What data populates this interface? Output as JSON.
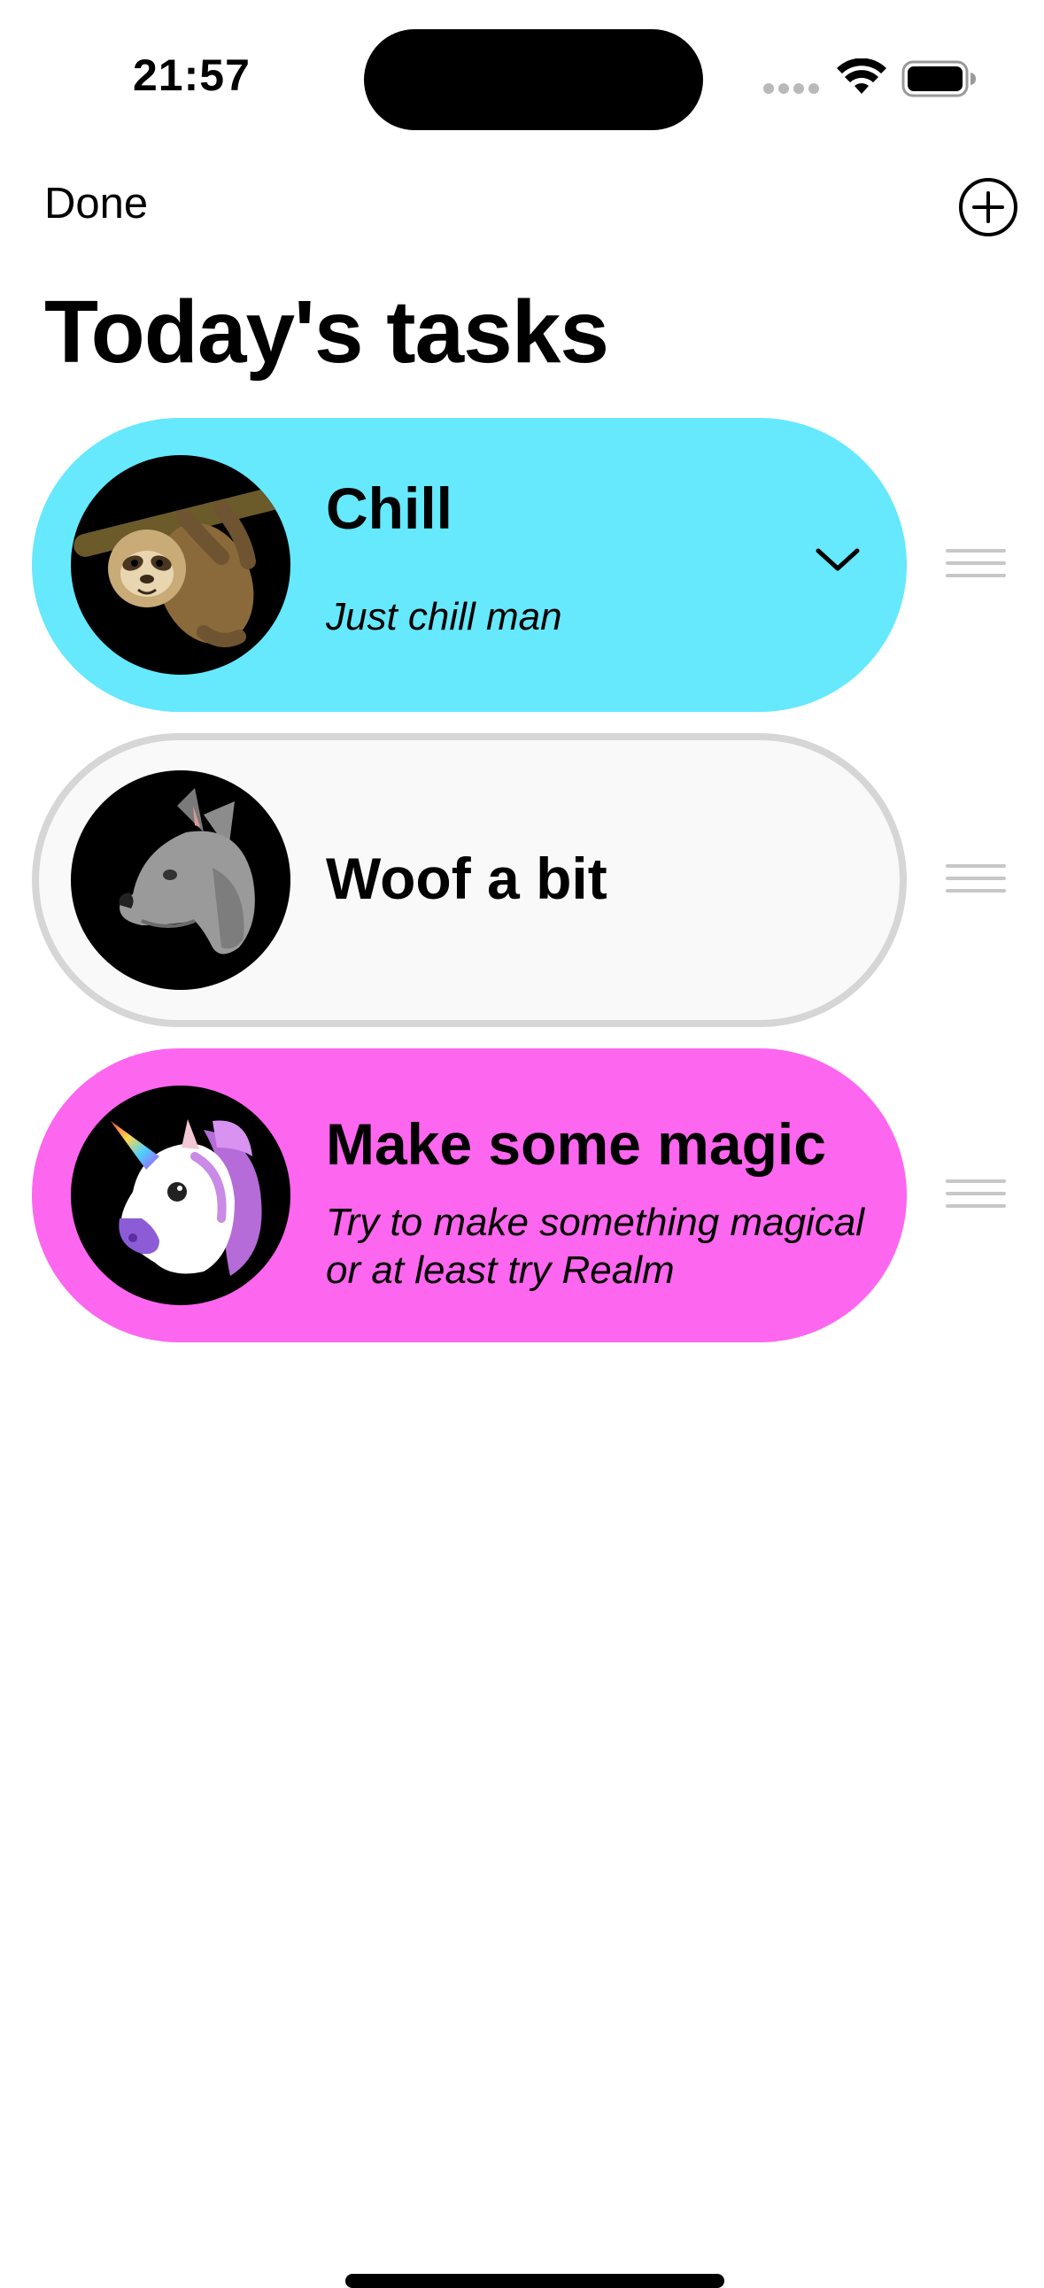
{
  "status_bar": {
    "time": "21:57"
  },
  "nav": {
    "done_label": "Done",
    "add_icon": "plus-circle-icon"
  },
  "page": {
    "title": "Today's tasks"
  },
  "tasks": [
    {
      "title": "Chill",
      "description": "Just chill man",
      "emoji": "sloth",
      "color": "#66E8FD",
      "expanded": true
    },
    {
      "title": "Woof a bit",
      "description": "",
      "emoji": "wolf",
      "color": "#F9F9F9",
      "border_color": "#D6D6D6",
      "expanded": false
    },
    {
      "title": "Make some magic",
      "description": "Try to make something magical or at least try Realm",
      "emoji": "unicorn",
      "color": "#FD66EE",
      "expanded": false
    }
  ],
  "colors": {
    "background": "#FFFFFF",
    "text": "#000000",
    "drag_handle": "#C7C7C7"
  }
}
